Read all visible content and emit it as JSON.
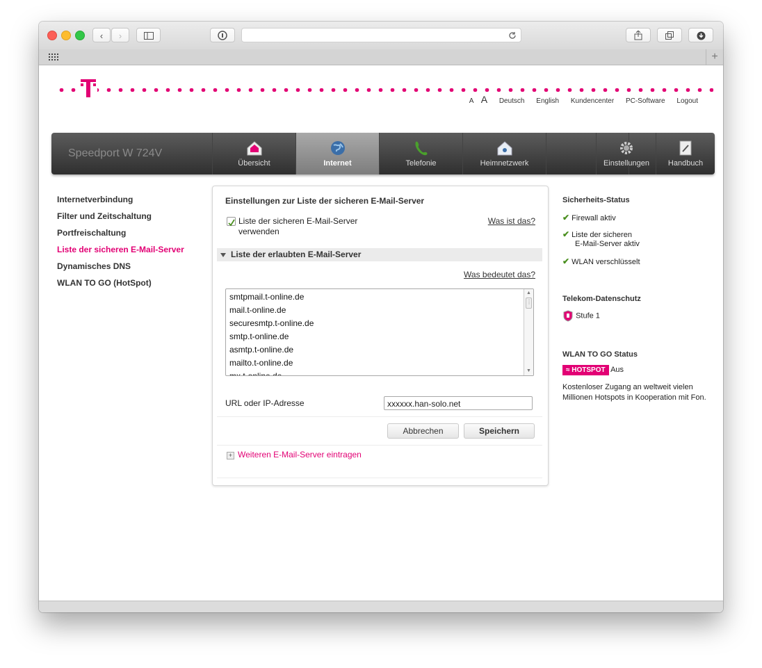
{
  "browser": {
    "url": "",
    "tabs_icon": "grid-icon"
  },
  "top_links": [
    "A",
    "A",
    "Deutsch",
    "English",
    "Kundencenter",
    "PC-Software",
    "Logout"
  ],
  "brand": "Speedport W 724V",
  "nav": [
    {
      "label": "Übersicht",
      "icon": "home-icon"
    },
    {
      "label": "Internet",
      "icon": "globe-icon"
    },
    {
      "label": "Telefonie",
      "icon": "phone-icon"
    },
    {
      "label": "Heimnetzwerk",
      "icon": "house-network-icon"
    },
    {
      "label": "Einstellungen",
      "icon": "gear-icon"
    },
    {
      "label": "Handbuch",
      "icon": "book-icon"
    }
  ],
  "left_menu": [
    "Internetverbindung",
    "Filter und Zeitschaltung",
    "Portfreischaltung",
    "Liste der sicheren E-Mail-Server",
    "Dynamisches DNS",
    "WLAN TO GO (HotSpot)"
  ],
  "panel": {
    "title": "Einstellungen zur Liste der sicheren E-Mail-Server",
    "checkbox_label": "Liste der sicheren E-Mail-Server verwenden",
    "what_is_it": "Was ist das?",
    "section_title": "Liste der erlaubten E-Mail-Server",
    "what_means": "Was bedeutet das?",
    "servers": [
      "smtpmail.t-online.de",
      "mail.t-online.de",
      "securesmtp.t-online.de",
      "smtp.t-online.de",
      "asmtp.t-online.de",
      "mailto.t-online.de",
      "mx.t-online.de"
    ],
    "url_label": "URL oder IP-Adresse",
    "url_value": "xxxxxx.han-solo.net",
    "cancel": "Abbrechen",
    "save": "Speichern",
    "add_more": "Weiteren E-Mail-Server eintragen"
  },
  "sidebar": {
    "security_title": "Sicherheits-Status",
    "security_items": [
      "Firewall aktiv",
      "Liste der sicheren",
      "E-Mail-Server aktiv",
      "WLAN verschlüsselt"
    ],
    "privacy_title": "Telekom-Datenschutz",
    "privacy_level": "Stufe 1",
    "wlan_title": "WLAN TO GO Status",
    "hotspot_badge": "HOTSPOT",
    "hotspot_state": "Aus",
    "wlan_text_1": "Kostenloser Zugang an weltweit vielen",
    "wlan_text_2": "Millionen Hotspots in Kooperation mit Fon."
  },
  "colors": {
    "magenta": "#e20074",
    "check": "#4a8f1f"
  }
}
